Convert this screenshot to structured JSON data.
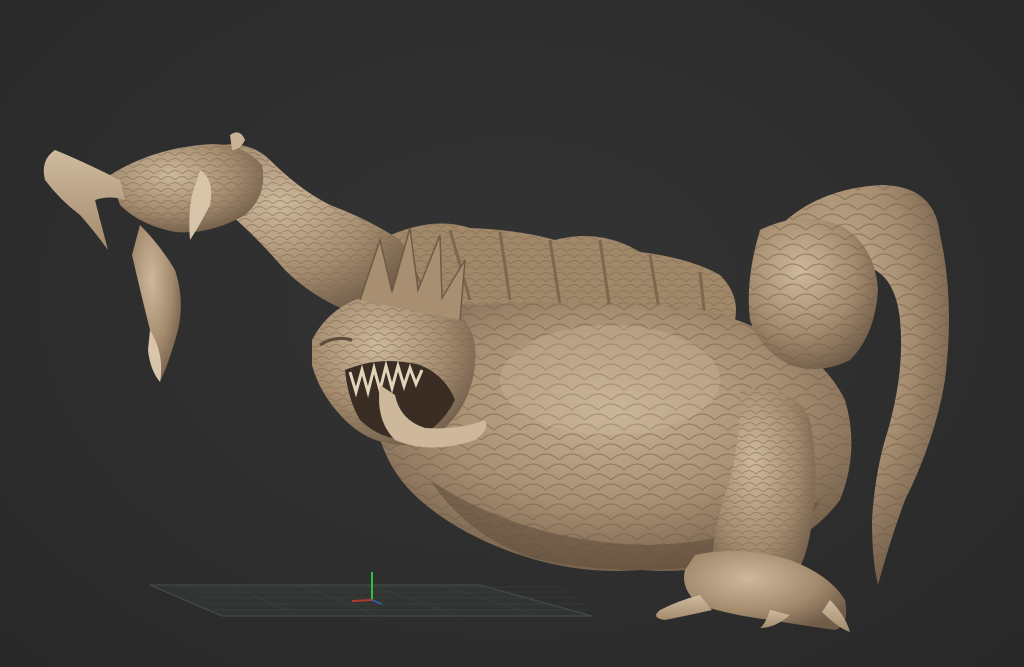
{
  "viewport": {
    "background_color": "#2e2e2e",
    "model": {
      "subject": "dragon-sculpt",
      "material_color": "#b19a7e",
      "shadow_color": "#6e5b48",
      "highlight_color": "#d2bea3"
    },
    "floor_grid": {
      "visible": true,
      "color": "#4a5650"
    },
    "axis_gizmo": {
      "visible": true,
      "y_color": "#2fbf3f",
      "x_color": "#b03a2e"
    }
  }
}
